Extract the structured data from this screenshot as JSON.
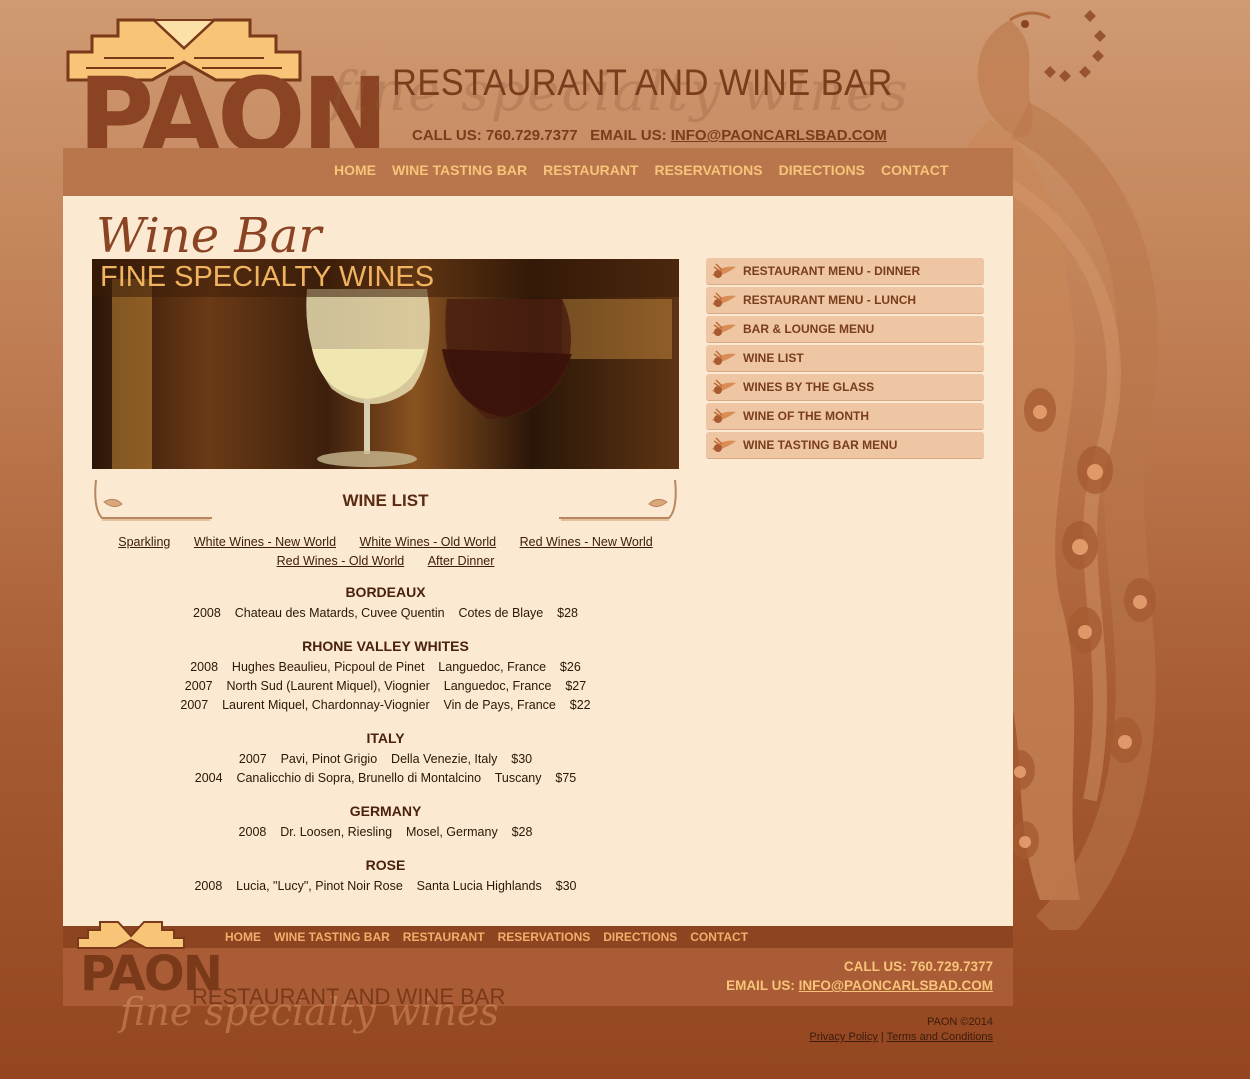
{
  "header": {
    "logo_text": "PAON",
    "script_text": "fine specialty wines",
    "title": "RESTAURANT AND WINE BAR",
    "call_label": "CALL US: 760.729.7377",
    "email_label": "EMAIL US:",
    "email": "INFO@PAONCARLSBAD.COM"
  },
  "nav": [
    {
      "label": "HOME"
    },
    {
      "label": "WINE TASTING BAR"
    },
    {
      "label": "RESTAURANT"
    },
    {
      "label": "RESERVATIONS"
    },
    {
      "label": "DIRECTIONS"
    },
    {
      "label": "CONTACT"
    }
  ],
  "main": {
    "page_title": "Wine Bar",
    "hero_caption": "FINE SPECIALTY WINES",
    "list_title": "WINE LIST",
    "categories": [
      "Sparkling",
      "White Wines - New World",
      "White Wines - Old World",
      "Red Wines - New World",
      "Red Wines - Old World",
      "After Dinner"
    ],
    "sections": [
      {
        "title": "BORDEAUX",
        "rows": [
          "2008    Chateau des Matards, Cuvee Quentin    Cotes de Blaye    $28"
        ]
      },
      {
        "title": "RHONE VALLEY WHITES",
        "rows": [
          "2008    Hughes Beaulieu, Picpoul de Pinet    Languedoc, France    $26",
          "2007    North Sud (Laurent Miquel), Viognier    Languedoc, France    $27",
          "2007    Laurent Miquel, Chardonnay-Viognier    Vin de Pays, France    $22"
        ]
      },
      {
        "title": "ITALY",
        "rows": [
          "2007    Pavi, Pinot Grigio    Della Venezie, Italy    $30",
          "2004    Canalicchio di Sopra, Brunello di Montalcino    Tuscany    $75"
        ]
      },
      {
        "title": "GERMANY",
        "rows": [
          "2008    Dr. Loosen, Riesling    Mosel, Germany    $28"
        ]
      },
      {
        "title": "ROSE",
        "rows": [
          "2008    Lucia, \"Lucy\", Pinot Noir Rose    Santa Lucia Highlands    $30"
        ]
      }
    ]
  },
  "sidebar": {
    "items": [
      {
        "label": "RESTAURANT MENU - DINNER"
      },
      {
        "label": "RESTAURANT MENU - LUNCH"
      },
      {
        "label": "BAR & LOUNGE MENU"
      },
      {
        "label": "WINE LIST"
      },
      {
        "label": "WINES BY THE GLASS"
      },
      {
        "label": "WINE OF THE MONTH"
      },
      {
        "label": "WINE TASTING BAR MENU"
      }
    ]
  },
  "footer": {
    "logo_text": "PAON",
    "title": "RESTAURANT AND WINE BAR",
    "script_text": "fine specialty wines",
    "call": "CALL US: 760.729.7377",
    "email_label": "EMAIL US:",
    "email": "INFO@PAONCARLSBAD.COM",
    "copyright": "PAON ©2014",
    "privacy": "Privacy Policy",
    "separator": "|",
    "terms": "Terms and Conditions"
  },
  "icons": {
    "sidebar_bullet": "peacock-feather-icon",
    "logo": "art-deco-logo-icon"
  },
  "colors": {
    "brand_brown": "#7a3d1c",
    "nav_gold": "#f7c47a",
    "content_bg": "#fbe9d1"
  }
}
